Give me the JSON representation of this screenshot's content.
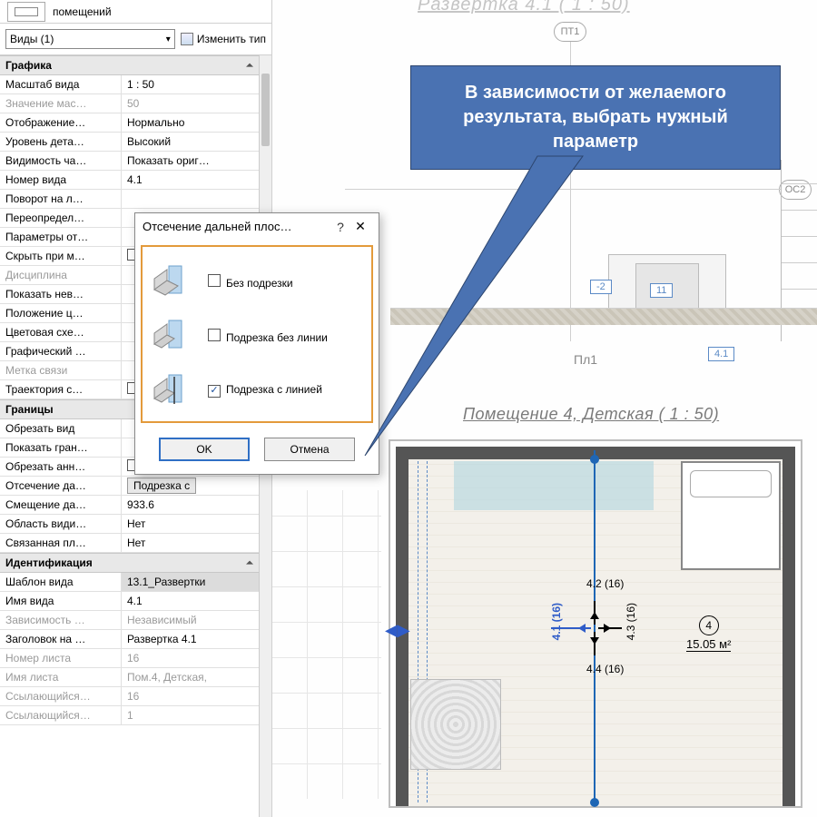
{
  "panel": {
    "top_label": "помещений",
    "type_selector": "Виды (1)",
    "edit_type": "Изменить тип"
  },
  "dialog": {
    "title": "Отсечение дальней плос…",
    "opt1": "Без подрезки",
    "opt2": "Подрезка без линии",
    "opt3": "Подрезка с линией",
    "ok": "OK",
    "cancel": "Отмена"
  },
  "callout": {
    "text": "В зависимости от желаемого результата, выбрать нужный параметр"
  },
  "canvas": {
    "title_top": "Развертка 4.1 ( 1 : 50)",
    "title_plan": "Помещение 4, Детская ( 1 : 50)",
    "grid_pt1": "ПТ1",
    "grid_os2": "ОС2",
    "level_pl1": "Пл1",
    "tag_small": "11",
    "tag_neg2": "-2",
    "view_tag": "4.1",
    "plan_room_no": "4",
    "plan_area": "15.05 м²",
    "dim_n": "4.2 (16)",
    "dim_e": "4.3 (16)",
    "dim_s": "4.4 (16)",
    "dim_w": "4.1 (16)"
  },
  "groups": [
    {
      "header": "Графика",
      "rows": [
        {
          "label": "Масштаб вида",
          "value": "1 : 50"
        },
        {
          "label": "Значение мас…",
          "value": "50",
          "disabled": true
        },
        {
          "label": "Отображение…",
          "value": "Нормально"
        },
        {
          "label": "Уровень дета…",
          "value": "Высокий"
        },
        {
          "label": "Видимость ча…",
          "value": "Показать ориг…"
        },
        {
          "label": "Номер вида",
          "value": "4.1"
        },
        {
          "label": "Поворот на л…",
          "value": ""
        },
        {
          "label": "Переопредел…",
          "value": ""
        },
        {
          "label": "Параметры от…",
          "value": ""
        },
        {
          "label": "Скрыть при м…",
          "value": "",
          "checkbox": true
        },
        {
          "label": "Дисциплина",
          "value": "",
          "disabled": true
        },
        {
          "label": "Показать нев…",
          "value": ""
        },
        {
          "label": "Положение ц…",
          "value": ""
        },
        {
          "label": "Цветовая схе…",
          "value": ""
        },
        {
          "label": "Графический …",
          "value": ""
        },
        {
          "label": "Метка связи",
          "value": "",
          "disabled": true
        },
        {
          "label": "Траектория с…",
          "value": "",
          "checkbox": true
        }
      ]
    },
    {
      "header": "Границы",
      "rows": [
        {
          "label": "Обрезать вид",
          "value": ""
        },
        {
          "label": "Показать гран…",
          "value": ""
        },
        {
          "label": "Обрезать анн…",
          "value": "",
          "checkbox": true
        },
        {
          "label": "Отсечение да…",
          "value": "Подрезка с",
          "button": true
        },
        {
          "label": "Смещение да…",
          "value": "933.6"
        },
        {
          "label": "Область види…",
          "value": "Нет"
        },
        {
          "label": "Связанная пл…",
          "value": "Нет"
        }
      ]
    },
    {
      "header": "Идентификация",
      "rows": [
        {
          "label": "Шаблон вида",
          "value": "13.1_Развертки",
          "highlight": true
        },
        {
          "label": "Имя вида",
          "value": "4.1"
        },
        {
          "label": "Зависимость …",
          "value": "Независимый",
          "disabled": true
        },
        {
          "label": "Заголовок на …",
          "value": "Развертка 4.1"
        },
        {
          "label": "Номер листа",
          "value": "16",
          "disabled": true
        },
        {
          "label": "Имя листа",
          "value": "Пом.4, Детская,",
          "disabled": true
        },
        {
          "label": "Ссылающийся…",
          "value": "16",
          "disabled": true
        },
        {
          "label": "Ссылающийся…",
          "value": "1",
          "disabled": true
        }
      ]
    }
  ]
}
